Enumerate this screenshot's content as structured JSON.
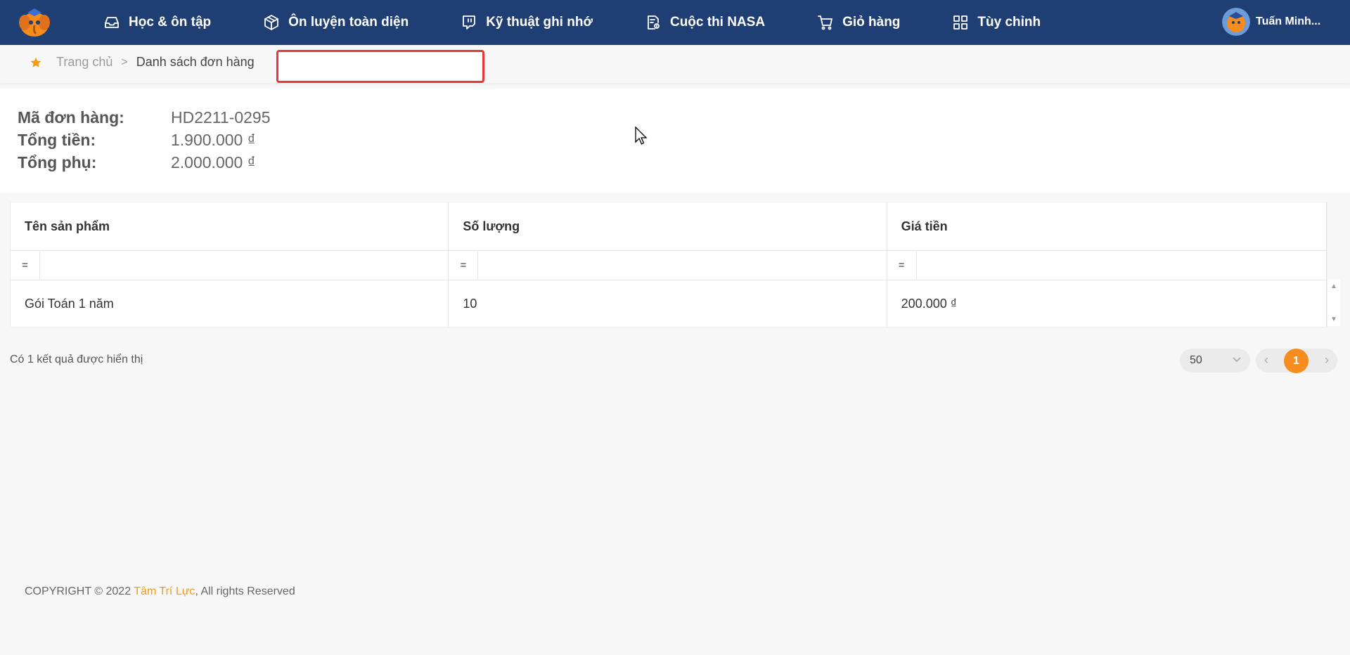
{
  "nav": {
    "items": [
      {
        "label": "Học & ôn tập",
        "icon": "inbox-icon"
      },
      {
        "label": "Ôn luyện toàn diện",
        "icon": "box-icon"
      },
      {
        "label": "Kỹ thuật ghi nhớ",
        "icon": "twitch-icon"
      },
      {
        "label": "Cuộc thi NASA",
        "icon": "contest-doc-icon"
      },
      {
        "label": "Giỏ hàng",
        "icon": "cart-icon"
      },
      {
        "label": "Tùy chỉnh",
        "icon": "grid-icon"
      }
    ],
    "user_name": "Tuấn Minh..."
  },
  "breadcrumb": {
    "home": "Trang chủ",
    "separator": ">",
    "current": "Danh sách đơn hàng"
  },
  "order": {
    "code_label": "Mã đơn hàng:",
    "code_value": "HD2211-0295",
    "total_label": "Tổng tiền:",
    "total_value": "1.900.000 ₫",
    "extra_label": "Tổng phụ:",
    "extra_value": "2.000.000 ₫"
  },
  "table": {
    "columns": [
      "Tên sản phẩm",
      "Số lượng",
      "Giá tiền"
    ],
    "filter_op": "=",
    "rows": [
      [
        "Gói Toán 1 năm",
        "10",
        "200.000 ₫"
      ]
    ]
  },
  "result_text": "Có 1 kết quả được hiển thị",
  "pagination": {
    "page_size": "50",
    "current_page": "1",
    "prev": "‹",
    "next": "›"
  },
  "footer": {
    "prefix": "COPYRIGHT © 2022 ",
    "brand": "Tâm Trí Lực",
    "suffix": ", All rights Reserved"
  },
  "colors": {
    "navbar": "#1f3f74",
    "accent": "#f68b1e",
    "highlight_box": "#e53935"
  }
}
